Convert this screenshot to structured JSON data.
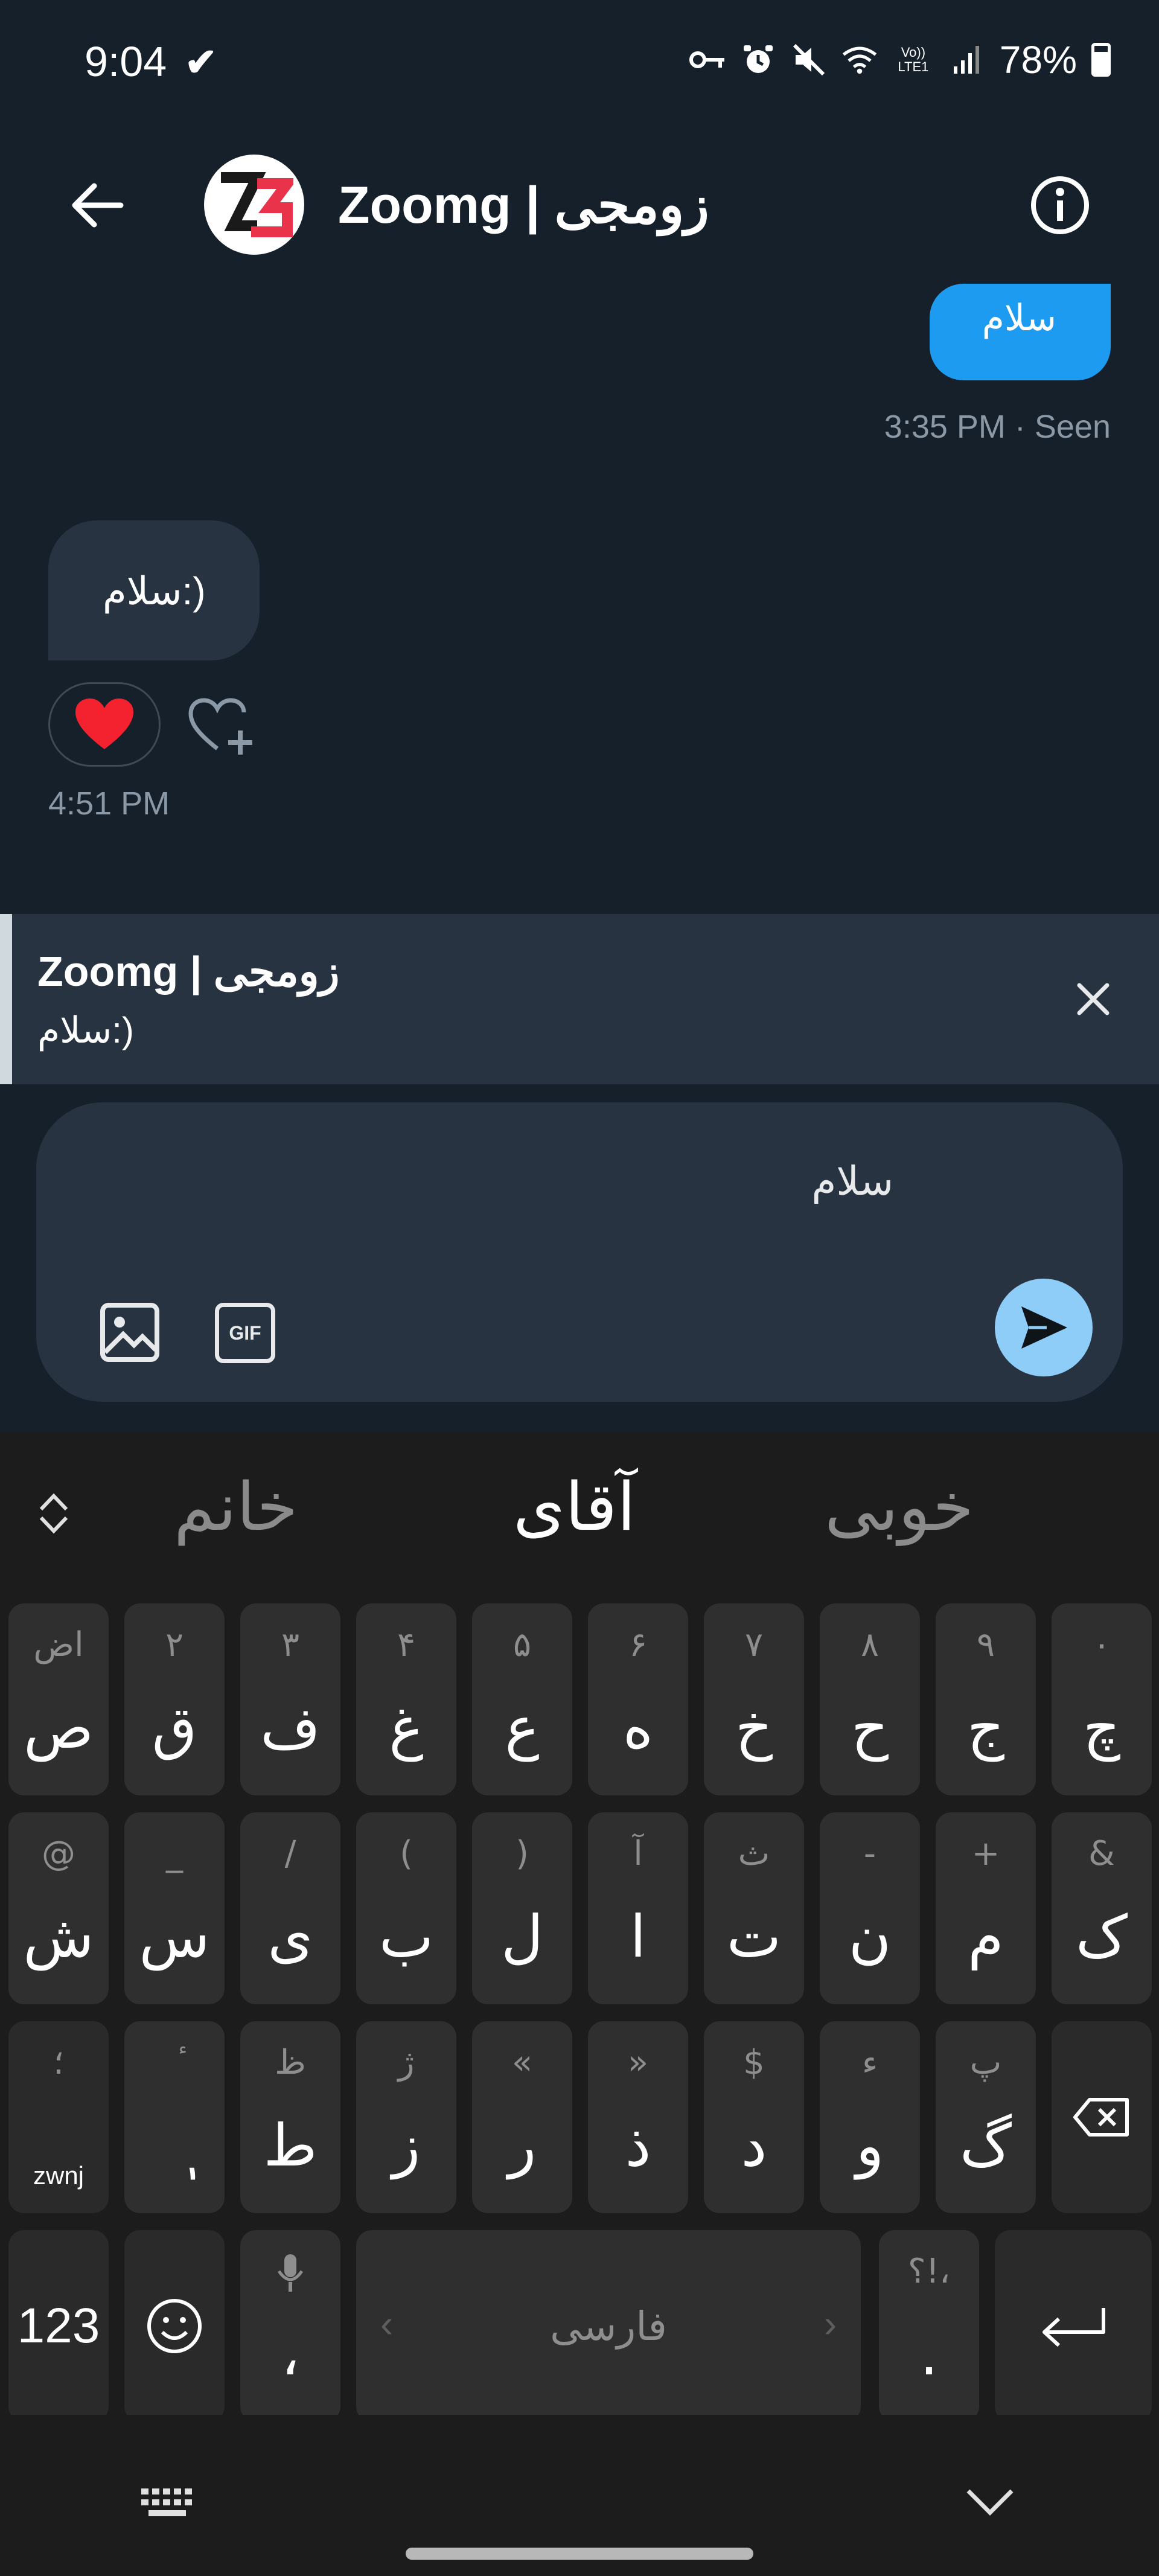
{
  "status_bar": {
    "time": "9:04",
    "network_label": "Vo)) LTE1",
    "battery": "78%"
  },
  "header": {
    "title": "Zoomg | زومجی",
    "avatar_text": "Z"
  },
  "messages": {
    "outgoing": {
      "text": "سلام",
      "meta": "3:35 PM · Seen"
    },
    "incoming": {
      "text": "سلام:)",
      "reaction": "❤",
      "meta": "4:51 PM"
    }
  },
  "reply_preview": {
    "name": "Zoomg | زومجی",
    "text": "سلام:)"
  },
  "composer": {
    "value": "سلام",
    "gif_label": "GIF"
  },
  "keyboard": {
    "suggestions": [
      "خانم",
      "آقای",
      "خوبی"
    ],
    "rows": [
      [
        {
          "hint": "اض",
          "main": "ص"
        },
        {
          "hint": "۲",
          "main": "ق"
        },
        {
          "hint": "۳",
          "main": "ف"
        },
        {
          "hint": "۴",
          "main": "غ"
        },
        {
          "hint": "۵",
          "main": "ع"
        },
        {
          "hint": "۶",
          "main": "ه"
        },
        {
          "hint": "۷",
          "main": "خ"
        },
        {
          "hint": "۸",
          "main": "ح"
        },
        {
          "hint": "۹",
          "main": "ج"
        },
        {
          "hint": "۰",
          "main": "چ"
        }
      ],
      [
        {
          "hint": "@",
          "main": "ش"
        },
        {
          "hint": "_",
          "main": "س"
        },
        {
          "hint": "/",
          "main": "ی"
        },
        {
          "hint": "(",
          "main": "ب"
        },
        {
          "hint": ")",
          "main": "ل"
        },
        {
          "hint": "آ",
          "main": "ا"
        },
        {
          "hint": "ث",
          "main": "ت"
        },
        {
          "hint": "-",
          "main": "ن"
        },
        {
          "hint": "+",
          "main": "م"
        },
        {
          "hint": "&",
          "main": "ک"
        }
      ],
      [
        {
          "hint": "؛",
          "main": "",
          "sub": "zwnj"
        },
        {
          "hint": "ٔ",
          "main": "ٖ"
        },
        {
          "hint": "ظ",
          "main": "ط"
        },
        {
          "hint": "ژ",
          "main": "ز"
        },
        {
          "hint": "«",
          "main": "ر"
        },
        {
          "hint": "»",
          "main": "ذ"
        },
        {
          "hint": "$",
          "main": "د"
        },
        {
          "hint": "ء",
          "main": "و"
        },
        {
          "hint": "پ",
          "main": "گ"
        }
      ]
    ],
    "bottom": {
      "numbers": "123",
      "comma_key": "،",
      "space": "فارسی",
      "punct_hint": "؟!،",
      "period": "."
    }
  }
}
